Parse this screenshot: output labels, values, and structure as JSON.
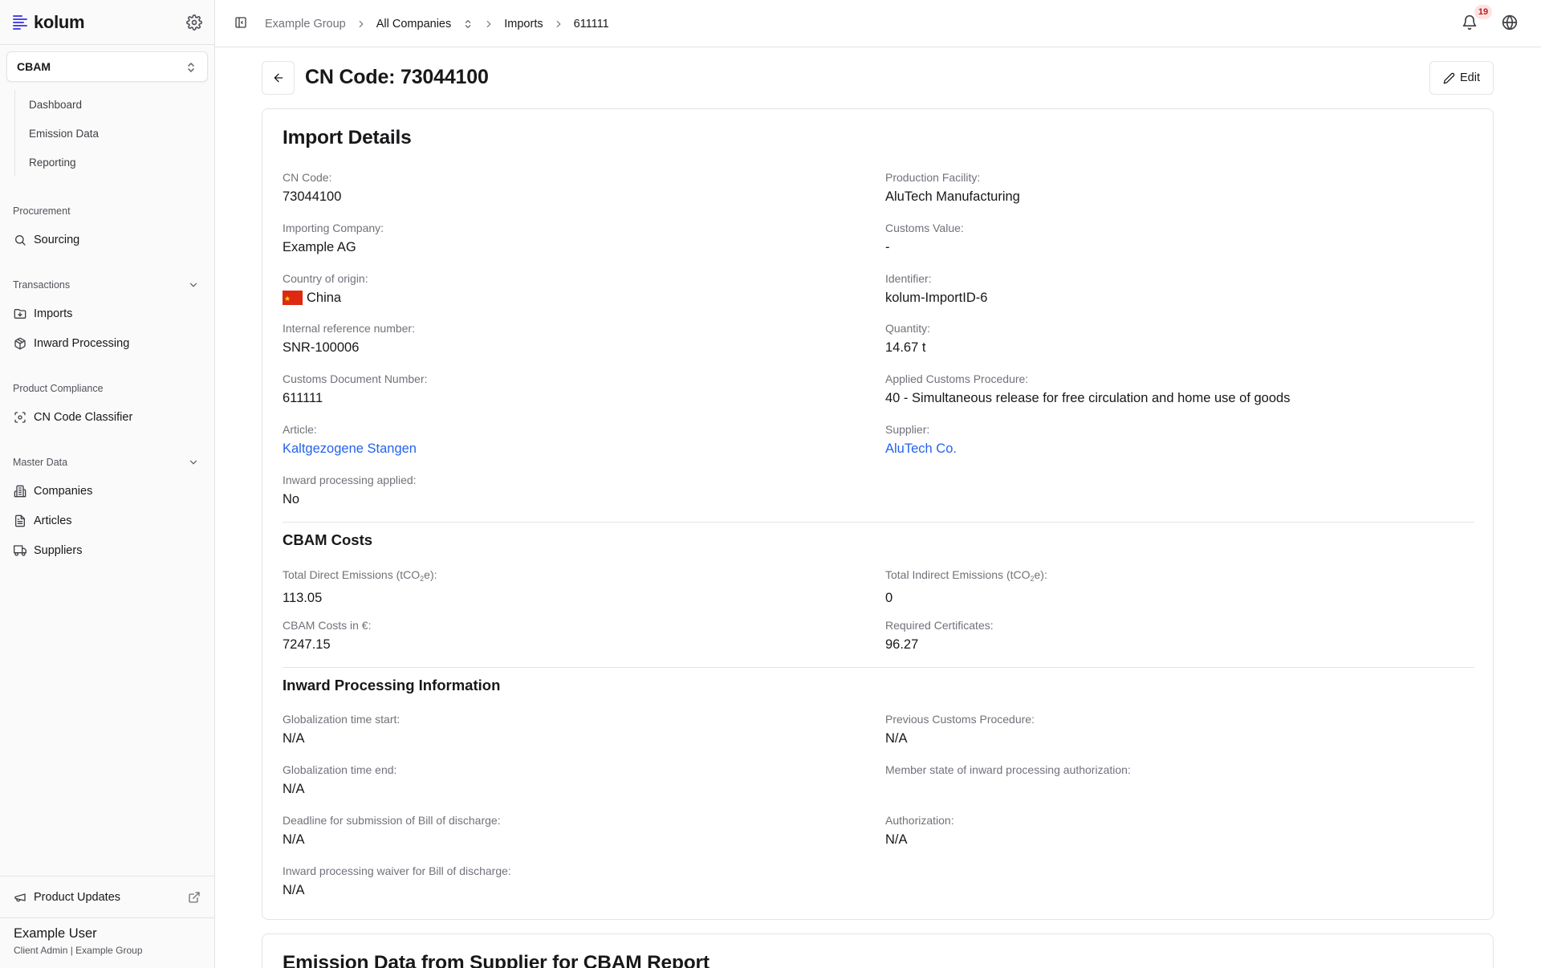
{
  "brand": {
    "name": "kolum"
  },
  "module": {
    "selected": "CBAM"
  },
  "sidebar": {
    "sub_items": [
      {
        "label": "Dashboard"
      },
      {
        "label": "Emission Data"
      },
      {
        "label": "Reporting"
      }
    ],
    "procurement": {
      "label": "Procurement",
      "items": [
        {
          "label": "Sourcing"
        }
      ]
    },
    "transactions": {
      "label": "Transactions",
      "items": [
        {
          "label": "Imports"
        },
        {
          "label": "Inward Processing"
        }
      ]
    },
    "compliance": {
      "label": "Product Compliance",
      "items": [
        {
          "label": "CN Code Classifier"
        }
      ]
    },
    "master": {
      "label": "Master Data",
      "items": [
        {
          "label": "Companies"
        },
        {
          "label": "Articles"
        },
        {
          "label": "Suppliers"
        }
      ]
    },
    "product_updates": "Product Updates",
    "user": {
      "name": "Example User",
      "role": "Client Admin | Example Group"
    }
  },
  "header": {
    "breadcrumbs": [
      "Example Group",
      "All Companies",
      "Imports",
      "611111"
    ],
    "notification_count": "19"
  },
  "page": {
    "title": "CN Code: 73044100",
    "edit_label": "Edit"
  },
  "import_details": {
    "title": "Import Details",
    "left": [
      {
        "label": "CN Code:",
        "value": "73044100"
      },
      {
        "label": "Importing Company:",
        "value": "Example AG"
      },
      {
        "label": "Country of origin:",
        "value": "China"
      },
      {
        "label": "Internal reference number:",
        "value": "SNR-100006"
      },
      {
        "label": "Customs Document Number:",
        "value": "611111"
      },
      {
        "label": "Article:",
        "value": "Kaltgezogene Stangen"
      },
      {
        "label": "Inward processing applied:",
        "value": "No"
      }
    ],
    "right": [
      {
        "label": "Production Facility:",
        "value": "AluTech Manufacturing"
      },
      {
        "label": "Customs Value:",
        "value": "-"
      },
      {
        "label": "Identifier:",
        "value": "kolum-ImportID-6"
      },
      {
        "label": "Quantity:",
        "value": "14.67 t"
      },
      {
        "label": "Applied Customs Procedure:",
        "value": "40 - Simultaneous release for free circulation and home use of goods"
      },
      {
        "label": "Supplier:",
        "value": "AluTech Co."
      }
    ]
  },
  "cbam_costs": {
    "title": "CBAM Costs",
    "direct_label_a": "Total Direct Emissions (tCO",
    "direct_label_sub": "2",
    "direct_label_b": "e):",
    "direct_value": "113.05",
    "indirect_label_a": "Total Indirect Emissions (tCO",
    "indirect_label_sub": "2",
    "indirect_label_b": "e):",
    "indirect_value": "0",
    "costs_label": "CBAM Costs in €:",
    "costs_value": "7247.15",
    "certs_label": "Required Certificates:",
    "certs_value": "96.27"
  },
  "inward": {
    "title": "Inward Processing Information",
    "left": [
      {
        "label": "Globalization time start:",
        "value": "N/A"
      },
      {
        "label": "Globalization time end:",
        "value": "N/A"
      },
      {
        "label": "Deadline for submission of Bill of discharge:",
        "value": "N/A"
      },
      {
        "label": "Inward processing waiver for Bill of discharge:",
        "value": "N/A"
      }
    ],
    "right": [
      {
        "label": "Previous Customs Procedure:",
        "value": "N/A"
      },
      {
        "label": "Member state of inward processing authorization:",
        "value": ""
      },
      {
        "label": "Authorization:",
        "value": "N/A"
      }
    ]
  },
  "emission_section": {
    "title": "Emission Data from Supplier for CBAM Report"
  },
  "colors": {
    "link": "#2563eb",
    "badge_bg": "#fee2e2",
    "badge_text": "#b91c1c",
    "brand": "#4f46e5"
  }
}
